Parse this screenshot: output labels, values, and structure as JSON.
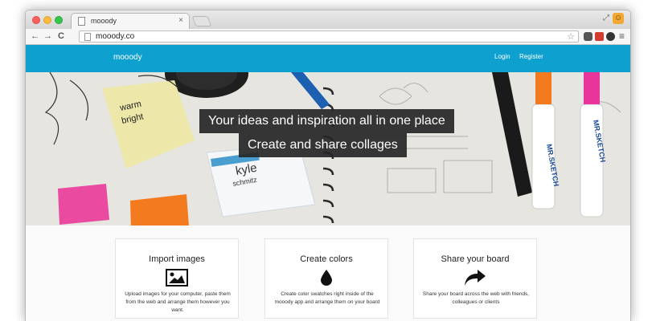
{
  "browser": {
    "tab_title": "mooody",
    "tab_close": "×",
    "url": "mooody.co",
    "nav": {
      "back": "←",
      "forward": "→",
      "reload": "C"
    },
    "menu": "≡"
  },
  "site": {
    "brand": "mooody",
    "nav": {
      "login": "Login",
      "register": "Register"
    }
  },
  "hero": {
    "line1": "Your ideas and inspiration all in one place",
    "line2": "Create and share collages"
  },
  "features": [
    {
      "title": "Import images",
      "icon": "image-icon",
      "description": "Upload images for your computer, paste them from the web and arrange them however you want."
    },
    {
      "title": "Create colors",
      "icon": "drop-icon",
      "description": "Create color swatches right inside of the mooody app and arrange them on your board"
    },
    {
      "title": "Share your board",
      "icon": "share-icon",
      "description": "Share your board across the web with friends, colleagues or clients"
    }
  ],
  "colors": {
    "accent": "#0ea0cf",
    "overlay": "#262626"
  }
}
